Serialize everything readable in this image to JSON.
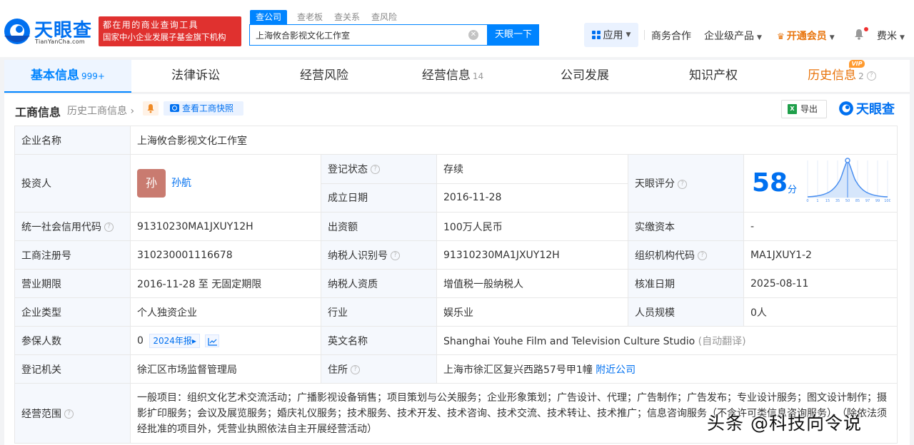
{
  "brand": {
    "name_cn": "天眼查",
    "name_en": "TianYanCha.com",
    "slogan_line1": "都在用的商业查询工具",
    "slogan_line2": "国家中小企业发展子基金旗下机构"
  },
  "search": {
    "tabs": [
      "查公司",
      "查老板",
      "查关系",
      "查风险"
    ],
    "value": "上海攸合影视文化工作室",
    "button": "天眼一下"
  },
  "nav": {
    "apps": "应用",
    "business": "商务合作",
    "enterprise": "企业级产品",
    "vip": "开通会员",
    "user": "费米"
  },
  "tabs": [
    {
      "label": "基本信息",
      "count": "999+"
    },
    {
      "label": "法律诉讼",
      "count": ""
    },
    {
      "label": "经营风险",
      "count": ""
    },
    {
      "label": "经营信息",
      "count": "14"
    },
    {
      "label": "公司发展",
      "count": ""
    },
    {
      "label": "知识产权",
      "count": ""
    },
    {
      "label": "历史信息",
      "count": "2",
      "badge": "VIP"
    }
  ],
  "section": {
    "title": "工商信息",
    "history_link": "历史工商信息",
    "snapshot": "查看工商快照",
    "export": "导出",
    "logo_text": "天眼查"
  },
  "info": {
    "company_name_label": "企业名称",
    "company_name": "上海攸合影视文化工作室",
    "investor_label": "投资人",
    "investor_avatar": "孙",
    "investor_name": "孙航",
    "reg_status_label": "登记状态",
    "reg_status": "存续",
    "found_date_label": "成立日期",
    "found_date": "2016-11-28",
    "score_label": "天眼评分",
    "score": "58",
    "score_unit": "分",
    "score_axis": [
      "0",
      "1",
      "15",
      "35",
      "50",
      "85",
      "97",
      "99",
      "100"
    ],
    "credit_code_label": "统一社会信用代码",
    "credit_code": "91310230MA1JXUY12H",
    "capital_label": "出资额",
    "capital": "100万人民币",
    "paid_capital_label": "实缴资本",
    "paid_capital": "-",
    "reg_no_label": "工商注册号",
    "reg_no": "310230001116678",
    "taxpayer_id_label": "纳税人识别号",
    "taxpayer_id": "91310230MA1JXUY12H",
    "org_code_label": "组织机构代码",
    "org_code": "MA1JXUY1-2",
    "term_label": "营业期限",
    "term": "2016-11-28 至 无固定期限",
    "tax_qual_label": "纳税人资质",
    "tax_qual": "增值税一般纳税人",
    "approve_date_label": "核准日期",
    "approve_date": "2025-08-11",
    "type_label": "企业类型",
    "type": "个人独资企业",
    "industry_label": "行业",
    "industry": "娱乐业",
    "staff_label": "人员规模",
    "staff": "0人",
    "insured_label": "参保人数",
    "insured": "0",
    "insured_year": "2024年报",
    "en_name_label": "英文名称",
    "en_name": "Shanghai Youhe Film and Television Culture Studio",
    "en_name_note": "(自动翻译)",
    "authority_label": "登记机关",
    "authority": "徐汇区市场监督管理局",
    "address_label": "住所",
    "address": "上海市徐汇区复兴西路57号甲1幢",
    "nearby": "附近公司",
    "scope_label": "经营范围",
    "scope": "一般项目：组织文化艺术交流活动；广播影视设备销售；项目策划与公关服务；企业形象策划；广告设计、代理；广告制作；广告发布；专业设计服务；图文设计制作；摄影扩印服务；会议及展览服务；婚庆礼仪服务；技术服务、技术开发、技术咨询、技术交流、技术转让、技术推广；信息咨询服务（不含许可类信息咨询服务）。（除依法须经批准的项目外，凭营业执照依法自主开展经营活动）"
  },
  "watermark": "头条 @科技向令说",
  "colors": {
    "accent": "#0084ff",
    "brand_red": "#e0312f",
    "vip_orange": "#e8730a",
    "status_green": "#12a05c"
  }
}
